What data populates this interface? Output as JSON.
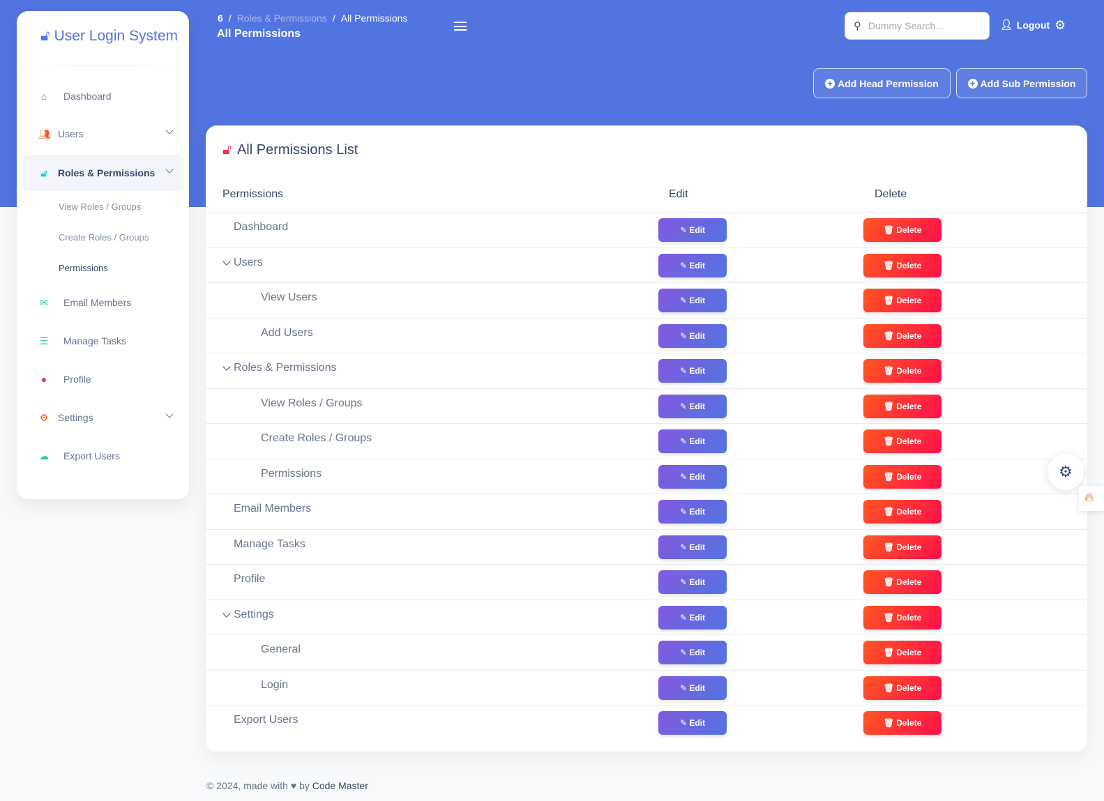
{
  "app": {
    "title": "User Login System"
  },
  "sidebar": {
    "items": [
      {
        "label": "Dashboard"
      },
      {
        "label": "Users"
      },
      {
        "label": "Roles & Permissions"
      },
      {
        "label": "Email Members"
      },
      {
        "label": "Manage Tasks"
      },
      {
        "label": "Profile"
      },
      {
        "label": "Settings"
      },
      {
        "label": "Export Users"
      }
    ],
    "sub_items": [
      {
        "label": "View Roles / Groups"
      },
      {
        "label": "Create Roles / Groups"
      },
      {
        "label": "Permissions"
      }
    ]
  },
  "header": {
    "breadcrumb": [
      "Roles & Permissions",
      "All Permissions"
    ],
    "page_title": "All Permissions",
    "search_placeholder": "Dummy Search...",
    "logout_label": "Logout",
    "add_head_label": "Add Head Permission",
    "add_sub_label": "Add Sub Permission"
  },
  "card": {
    "title": "All Permissions List",
    "columns": [
      "Permissions",
      "Edit",
      "Delete"
    ],
    "edit_label": "Edit",
    "delete_label": "Delete",
    "rows": [
      {
        "name": "Dashboard",
        "level": 0,
        "expandable": false
      },
      {
        "name": "Users",
        "level": 0,
        "expandable": true
      },
      {
        "name": "View Users",
        "level": 1,
        "expandable": false
      },
      {
        "name": "Add Users",
        "level": 1,
        "expandable": false
      },
      {
        "name": "Roles & Permissions",
        "level": 0,
        "expandable": true
      },
      {
        "name": "View Roles / Groups",
        "level": 1,
        "expandable": false
      },
      {
        "name": "Create Roles / Groups",
        "level": 1,
        "expandable": false
      },
      {
        "name": "Permissions",
        "level": 1,
        "expandable": false
      },
      {
        "name": "Email Members",
        "level": 0,
        "expandable": false
      },
      {
        "name": "Manage Tasks",
        "level": 0,
        "expandable": false
      },
      {
        "name": "Profile",
        "level": 0,
        "expandable": false
      },
      {
        "name": "Settings",
        "level": 0,
        "expandable": true
      },
      {
        "name": "General",
        "level": 1,
        "expandable": false
      },
      {
        "name": "Login",
        "level": 1,
        "expandable": false
      },
      {
        "name": "Export Users",
        "level": 0,
        "expandable": false
      }
    ]
  },
  "footer": {
    "prefix": "© 2024, made with",
    "by": "by",
    "author": "Code Master"
  },
  "colors": {
    "primary": "#5274e0",
    "danger": "#ff0f4a",
    "text": "#344767"
  }
}
